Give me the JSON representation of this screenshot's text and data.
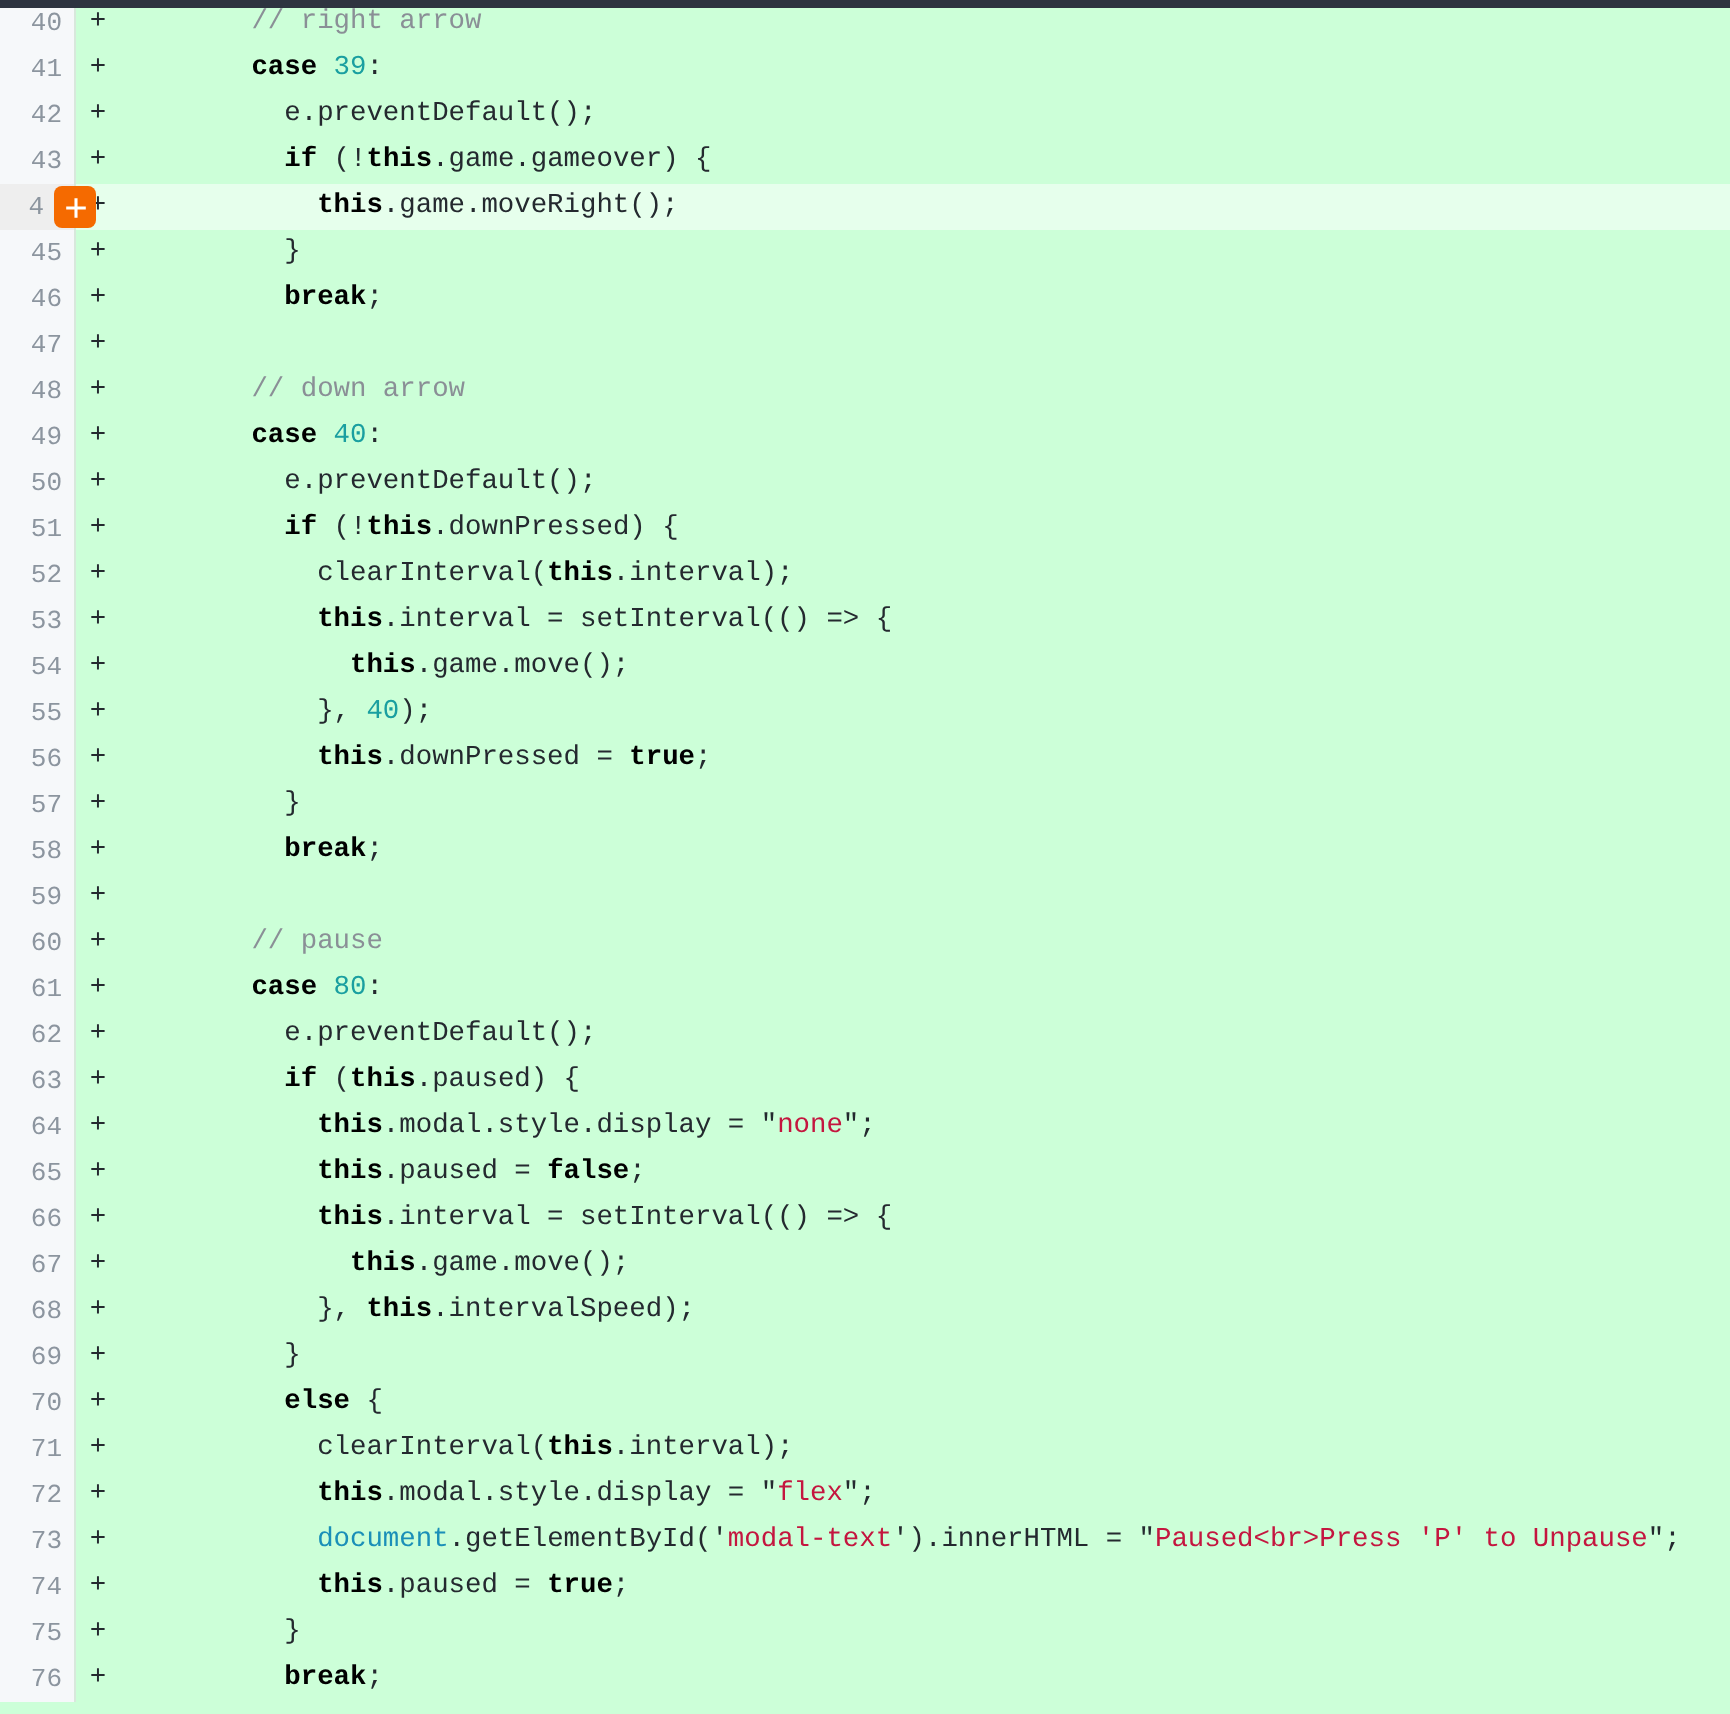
{
  "diff": {
    "lines": [
      {
        "number": "40",
        "sign": "+",
        "highlighted": false,
        "tokens": [
          {
            "kind": "comment",
            "text": "        // right arrow"
          }
        ]
      },
      {
        "number": "41",
        "sign": "+",
        "highlighted": false,
        "tokens": [
          {
            "kind": "keyword",
            "text": "        case"
          },
          {
            "kind": "number",
            "text": " 39"
          },
          {
            "kind": "plain",
            "text": ":"
          }
        ]
      },
      {
        "number": "42",
        "sign": "+",
        "highlighted": false,
        "tokens": [
          {
            "kind": "plain",
            "text": "          e.preventDefault();"
          }
        ]
      },
      {
        "number": "43",
        "sign": "+",
        "highlighted": false,
        "tokens": [
          {
            "kind": "keyword",
            "text": "          if"
          },
          {
            "kind": "plain",
            "text": " (!"
          },
          {
            "kind": "keyword",
            "text": "this"
          },
          {
            "kind": "plain",
            "text": ".game.gameover) {"
          }
        ]
      },
      {
        "number": "4",
        "sign": "+",
        "highlighted": true,
        "tokens": [
          {
            "kind": "keyword",
            "text": "            this"
          },
          {
            "kind": "plain",
            "text": ".game.moveRight();"
          }
        ]
      },
      {
        "number": "45",
        "sign": "+",
        "highlighted": false,
        "tokens": [
          {
            "kind": "plain",
            "text": "          }"
          }
        ]
      },
      {
        "number": "46",
        "sign": "+",
        "highlighted": false,
        "tokens": [
          {
            "kind": "keyword",
            "text": "          break"
          },
          {
            "kind": "plain",
            "text": ";"
          }
        ]
      },
      {
        "number": "47",
        "sign": "+",
        "highlighted": false
      },
      {
        "number": "48",
        "sign": "+",
        "highlighted": false,
        "tokens": [
          {
            "kind": "comment",
            "text": "        // down arrow"
          }
        ]
      },
      {
        "number": "49",
        "sign": "+",
        "highlighted": false,
        "tokens": [
          {
            "kind": "keyword",
            "text": "        case"
          },
          {
            "kind": "number",
            "text": " 40"
          },
          {
            "kind": "plain",
            "text": ":"
          }
        ]
      },
      {
        "number": "50",
        "sign": "+",
        "highlighted": false,
        "tokens": [
          {
            "kind": "plain",
            "text": "          e.preventDefault();"
          }
        ]
      },
      {
        "number": "51",
        "sign": "+",
        "highlighted": false,
        "tokens": [
          {
            "kind": "keyword",
            "text": "          if"
          },
          {
            "kind": "plain",
            "text": " (!"
          },
          {
            "kind": "keyword",
            "text": "this"
          },
          {
            "kind": "plain",
            "text": ".downPressed) {"
          }
        ]
      },
      {
        "number": "52",
        "sign": "+",
        "highlighted": false,
        "tokens": [
          {
            "kind": "plain",
            "text": "            clearInterval("
          },
          {
            "kind": "keyword",
            "text": "this"
          },
          {
            "kind": "plain",
            "text": ".interval);"
          }
        ]
      },
      {
        "number": "53",
        "sign": "+",
        "highlighted": false,
        "tokens": [
          {
            "kind": "keyword",
            "text": "            this"
          },
          {
            "kind": "plain",
            "text": ".interval = setInterval(() => {"
          }
        ]
      },
      {
        "number": "54",
        "sign": "+",
        "highlighted": false,
        "tokens": [
          {
            "kind": "keyword",
            "text": "              this"
          },
          {
            "kind": "plain",
            "text": ".game.move();"
          }
        ]
      },
      {
        "number": "55",
        "sign": "+",
        "highlighted": false,
        "tokens": [
          {
            "kind": "plain",
            "text": "            }, "
          },
          {
            "kind": "number",
            "text": "40"
          },
          {
            "kind": "plain",
            "text": ");"
          }
        ]
      },
      {
        "number": "56",
        "sign": "+",
        "highlighted": false,
        "tokens": [
          {
            "kind": "keyword",
            "text": "            this"
          },
          {
            "kind": "plain",
            "text": ".downPressed = "
          },
          {
            "kind": "keyword",
            "text": "true"
          },
          {
            "kind": "plain",
            "text": ";"
          }
        ]
      },
      {
        "number": "57",
        "sign": "+",
        "highlighted": false,
        "tokens": [
          {
            "kind": "plain",
            "text": "          }"
          }
        ]
      },
      {
        "number": "58",
        "sign": "+",
        "highlighted": false,
        "tokens": [
          {
            "kind": "keyword",
            "text": "          break"
          },
          {
            "kind": "plain",
            "text": ";"
          }
        ]
      },
      {
        "number": "59",
        "sign": "+",
        "highlighted": false
      },
      {
        "number": "60",
        "sign": "+",
        "highlighted": false,
        "tokens": [
          {
            "kind": "comment",
            "text": "        // pause"
          }
        ]
      },
      {
        "number": "61",
        "sign": "+",
        "highlighted": false,
        "tokens": [
          {
            "kind": "keyword",
            "text": "        case"
          },
          {
            "kind": "number",
            "text": " 80"
          },
          {
            "kind": "plain",
            "text": ":"
          }
        ]
      },
      {
        "number": "62",
        "sign": "+",
        "highlighted": false,
        "tokens": [
          {
            "kind": "plain",
            "text": "          e.preventDefault();"
          }
        ]
      },
      {
        "number": "63",
        "sign": "+",
        "highlighted": false,
        "tokens": [
          {
            "kind": "keyword",
            "text": "          if"
          },
          {
            "kind": "plain",
            "text": " ("
          },
          {
            "kind": "keyword",
            "text": "this"
          },
          {
            "kind": "plain",
            "text": ".paused) {"
          }
        ]
      },
      {
        "number": "64",
        "sign": "+",
        "highlighted": false,
        "tokens": [
          {
            "kind": "keyword",
            "text": "            this"
          },
          {
            "kind": "plain",
            "text": ".modal.style.display = \""
          },
          {
            "kind": "string",
            "text": "none"
          },
          {
            "kind": "plain",
            "text": "\";"
          }
        ]
      },
      {
        "number": "65",
        "sign": "+",
        "highlighted": false,
        "tokens": [
          {
            "kind": "keyword",
            "text": "            this"
          },
          {
            "kind": "plain",
            "text": ".paused = "
          },
          {
            "kind": "keyword",
            "text": "false"
          },
          {
            "kind": "plain",
            "text": ";"
          }
        ]
      },
      {
        "number": "66",
        "sign": "+",
        "highlighted": false,
        "tokens": [
          {
            "kind": "keyword",
            "text": "            this"
          },
          {
            "kind": "plain",
            "text": ".interval = setInterval(() => {"
          }
        ]
      },
      {
        "number": "67",
        "sign": "+",
        "highlighted": false,
        "tokens": [
          {
            "kind": "keyword",
            "text": "              this"
          },
          {
            "kind": "plain",
            "text": ".game.move();"
          }
        ]
      },
      {
        "number": "68",
        "sign": "+",
        "highlighted": false,
        "tokens": [
          {
            "kind": "plain",
            "text": "            }, "
          },
          {
            "kind": "keyword",
            "text": "this"
          },
          {
            "kind": "plain",
            "text": ".intervalSpeed);"
          }
        ]
      },
      {
        "number": "69",
        "sign": "+",
        "highlighted": false,
        "tokens": [
          {
            "kind": "plain",
            "text": "          }"
          }
        ]
      },
      {
        "number": "70",
        "sign": "+",
        "highlighted": false,
        "tokens": [
          {
            "kind": "keyword",
            "text": "          else"
          },
          {
            "kind": "plain",
            "text": " {"
          }
        ]
      },
      {
        "number": "71",
        "sign": "+",
        "highlighted": false,
        "tokens": [
          {
            "kind": "plain",
            "text": "            clearInterval("
          },
          {
            "kind": "keyword",
            "text": "this"
          },
          {
            "kind": "plain",
            "text": ".interval);"
          }
        ]
      },
      {
        "number": "72",
        "sign": "+",
        "highlighted": false,
        "tokens": [
          {
            "kind": "keyword",
            "text": "            this"
          },
          {
            "kind": "plain",
            "text": ".modal.style.display = \""
          },
          {
            "kind": "string",
            "text": "flex"
          },
          {
            "kind": "plain",
            "text": "\";"
          }
        ]
      },
      {
        "number": "73",
        "sign": "+",
        "highlighted": false,
        "tokens": [
          {
            "kind": "builtin",
            "text": "            document"
          },
          {
            "kind": "plain",
            "text": ".getElementById('"
          },
          {
            "kind": "string",
            "text": "modal-text"
          },
          {
            "kind": "plain",
            "text": "').innerHTML = \""
          },
          {
            "kind": "string",
            "text": "Paused<br>Press 'P' to Unpause"
          },
          {
            "kind": "plain",
            "text": "\";"
          }
        ]
      },
      {
        "number": "74",
        "sign": "+",
        "highlighted": false,
        "tokens": [
          {
            "kind": "keyword",
            "text": "            this"
          },
          {
            "kind": "plain",
            "text": ".paused = "
          },
          {
            "kind": "keyword",
            "text": "true"
          },
          {
            "kind": "plain",
            "text": ";"
          }
        ]
      },
      {
        "number": "75",
        "sign": "+",
        "highlighted": false,
        "tokens": [
          {
            "kind": "plain",
            "text": "          }"
          }
        ]
      },
      {
        "number": "76",
        "sign": "+",
        "highlighted": false,
        "tokens": [
          {
            "kind": "keyword",
            "text": "          break"
          },
          {
            "kind": "plain",
            "text": ";"
          }
        ]
      }
    ]
  }
}
